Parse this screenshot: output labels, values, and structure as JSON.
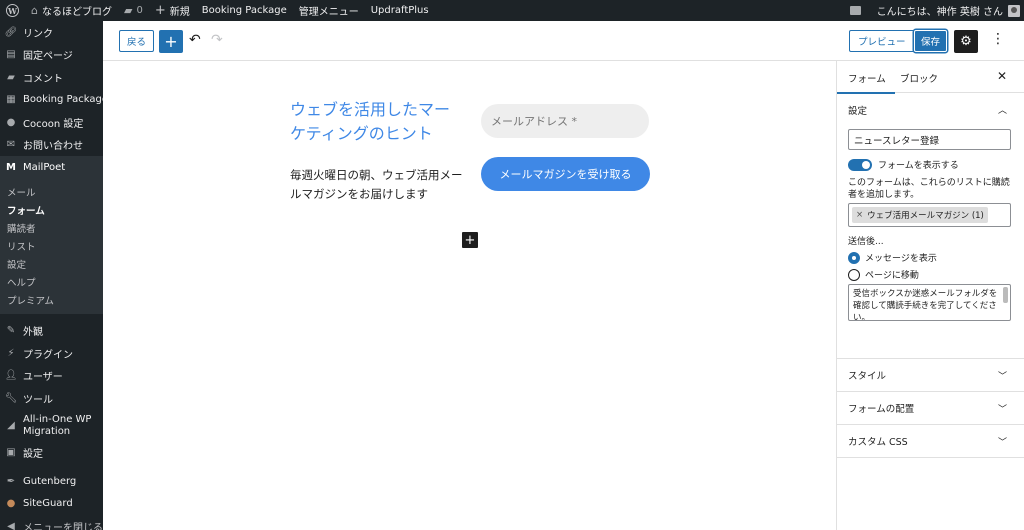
{
  "adminbar": {
    "site_name": "なるほどブログ",
    "comments_count": "0",
    "new_label": "新規",
    "booking": "Booking Package",
    "admin_menu": "管理メニュー",
    "updraft": "UpdraftPlus",
    "greeting": "こんにちは、神作 英樹 さん"
  },
  "sidebar": {
    "top_items": [
      {
        "icon": "link-icon",
        "label": "リンク"
      },
      {
        "icon": "page-icon",
        "label": "固定ページ"
      },
      {
        "icon": "comment-icon",
        "label": "コメント"
      },
      {
        "icon": "calendar-icon",
        "label": "Booking Package"
      },
      {
        "icon": "cocoon-icon",
        "label": "Cocoon 設定"
      },
      {
        "icon": "mail-icon",
        "label": "お問い合わせ"
      },
      {
        "icon": "mailpoet-icon",
        "label": "MailPoet"
      }
    ],
    "submenu": [
      "メール",
      "フォーム",
      "購読者",
      "リスト",
      "設定",
      "ヘルプ",
      "プレミアム"
    ],
    "bottom_items": [
      {
        "icon": "brush-icon",
        "label": "外観"
      },
      {
        "icon": "plugin-icon",
        "label": "プラグイン"
      },
      {
        "icon": "user-icon",
        "label": "ユーザー"
      },
      {
        "icon": "wrench-icon",
        "label": "ツール"
      },
      {
        "icon": "migration-icon",
        "label": "All-in-One WP Migration"
      },
      {
        "icon": "settings-icon",
        "label": "設定"
      },
      {
        "icon": "pen-icon",
        "label": "Gutenberg"
      },
      {
        "icon": "shield-icon",
        "label": "SiteGuard"
      },
      {
        "icon": "collapse-icon",
        "label": "メニューを閉じる"
      }
    ]
  },
  "toolbar": {
    "back_label": "戻る",
    "preview_label": "プレビュー",
    "save_label": "保存"
  },
  "form": {
    "title": "ウェブを活用したマーケティングのヒント",
    "description": "毎週火曜日の朝、ウェブ活用メールマガジンをお届けします",
    "email_placeholder": "メールアドレス *",
    "submit_label": "メールマガジンを受け取る"
  },
  "panel": {
    "tab_form": "フォーム",
    "tab_block": "ブロック",
    "settings_title": "設定",
    "form_name": "ニュースレター登録",
    "toggle_label": "フォームを表示する",
    "lists_help": "このフォームは、これらのリストに購読者を追加します。",
    "list_token": "ウェブ活用メールマガジン (1)",
    "after_submit": "送信後...",
    "radio_message": "メッセージを表示",
    "radio_redirect": "ページに移動",
    "message_text": "受信ボックスか迷惑メールフォルダを確認して購読手続きを完了してください。",
    "style_title": "スタイル",
    "placement_title": "フォームの配置",
    "custom_css_title": "カスタム CSS"
  }
}
